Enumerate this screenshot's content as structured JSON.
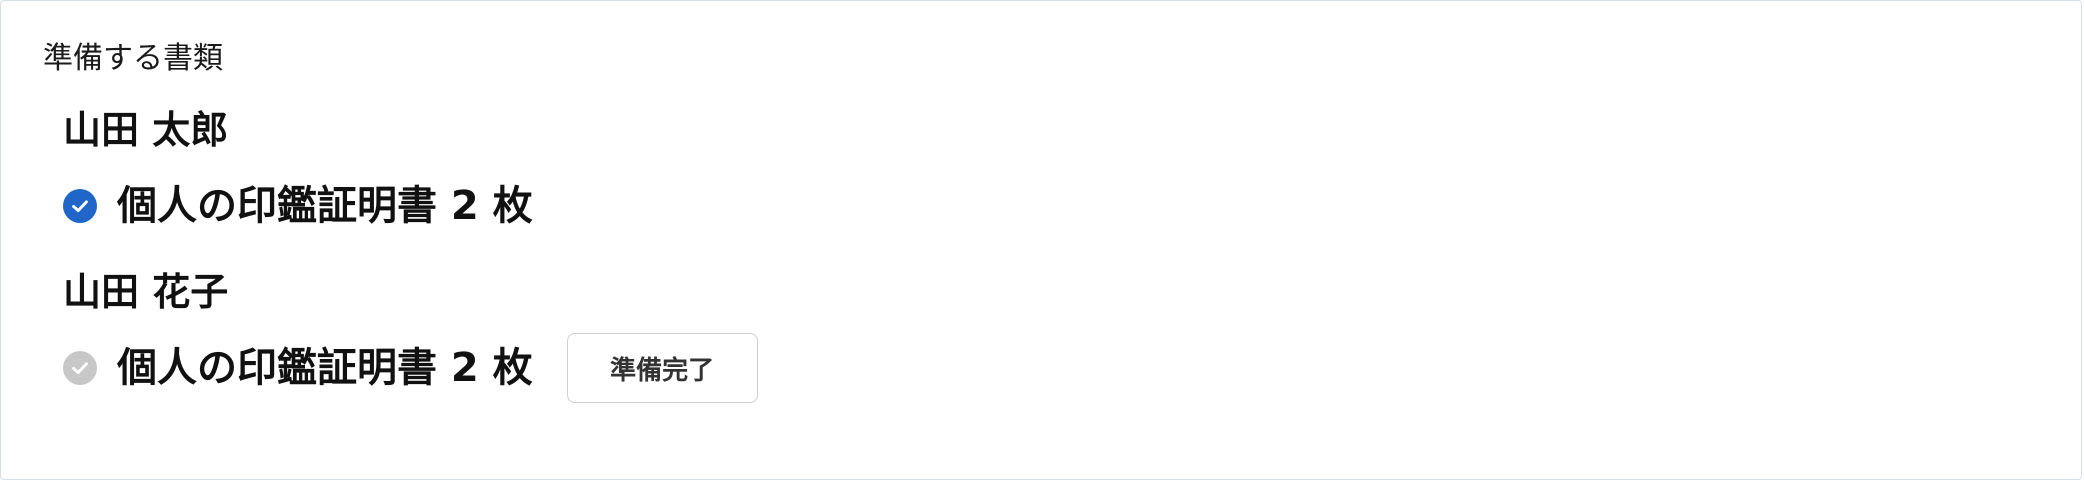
{
  "section": {
    "title": "準備する書類"
  },
  "people": [
    {
      "name": "山田 太郎",
      "document": {
        "label": "個人の印鑑証明書 2 枚",
        "status": "completed",
        "icon": "check-circle-icon",
        "icon_color": "#1f66c8"
      }
    },
    {
      "name": "山田 花子",
      "document": {
        "label": "個人の印鑑証明書 2 枚",
        "status": "pending",
        "icon": "check-circle-icon",
        "icon_color": "#c8c8c8",
        "action_label": "準備完了"
      }
    }
  ]
}
